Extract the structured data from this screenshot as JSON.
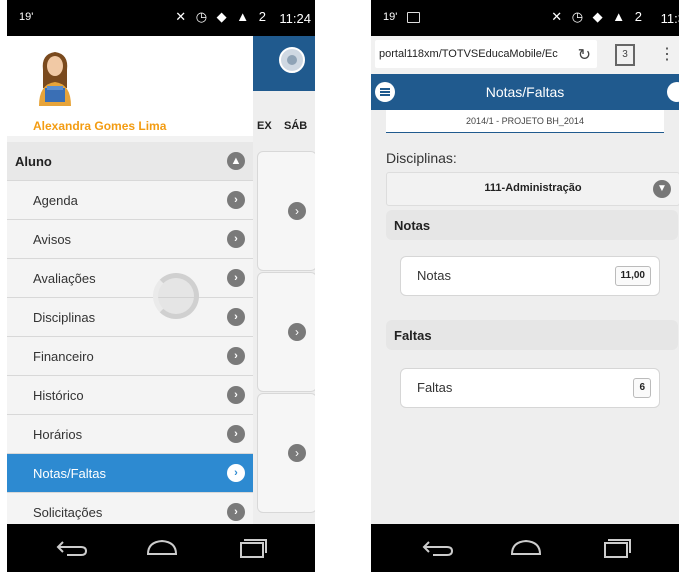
{
  "status_left": {
    "signal": "19'",
    "icons": "✕ ◷ ◆ ▲ 2",
    "time": "11:24"
  },
  "status_right": {
    "signal": "19'",
    "icons": "✕ ◷ ◆ ▲ 2",
    "time": "11:3"
  },
  "drawer": {
    "user_name": "Alexandra Gomes Lima",
    "menu": [
      {
        "label": "Aluno",
        "type": "section"
      },
      {
        "label": "Agenda"
      },
      {
        "label": "Avisos"
      },
      {
        "label": "Avaliações"
      },
      {
        "label": "Disciplinas"
      },
      {
        "label": "Financeiro"
      },
      {
        "label": "Histórico"
      },
      {
        "label": "Horários"
      },
      {
        "label": "Notas/Faltas",
        "active": true
      },
      {
        "label": "Solicitações"
      }
    ]
  },
  "schedule_bg": {
    "days": [
      "EX",
      "SÁB"
    ]
  },
  "browser": {
    "url": "portal118xm/TOTVSEducaMobile/Ec",
    "tab_count": "3"
  },
  "notas_page": {
    "title": "Notas/Faltas",
    "period": "2014/1 - PROJETO BH_2014",
    "disciplinas_label": "Disciplinas:",
    "selected_disciplina": "111-Administração",
    "notas_section": "Notas",
    "notas_label": "Notas",
    "notas_value": "11,00",
    "faltas_section": "Faltas",
    "faltas_label": "Faltas",
    "faltas_value": "6"
  },
  "colors": {
    "primary": "#205a8e",
    "active": "#2d8ad1",
    "name": "#f39c12"
  }
}
